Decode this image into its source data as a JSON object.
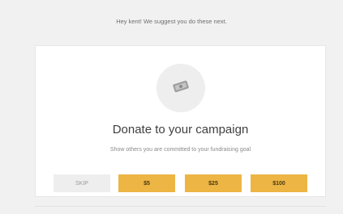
{
  "suggestion": {
    "text": "Hey kent! We suggest you do these next."
  },
  "card": {
    "icon": "money-icon",
    "title": "Donate to your campaign",
    "subtitle": "Show others you are committed to your fundraising goal"
  },
  "actions": {
    "skip_label": "SKIP",
    "amounts": [
      "$5",
      "$25",
      "$100"
    ]
  },
  "colors": {
    "accent": "#edb544",
    "background": "#f1f1f1",
    "card": "#ffffff",
    "skip": "#eeeeee"
  }
}
